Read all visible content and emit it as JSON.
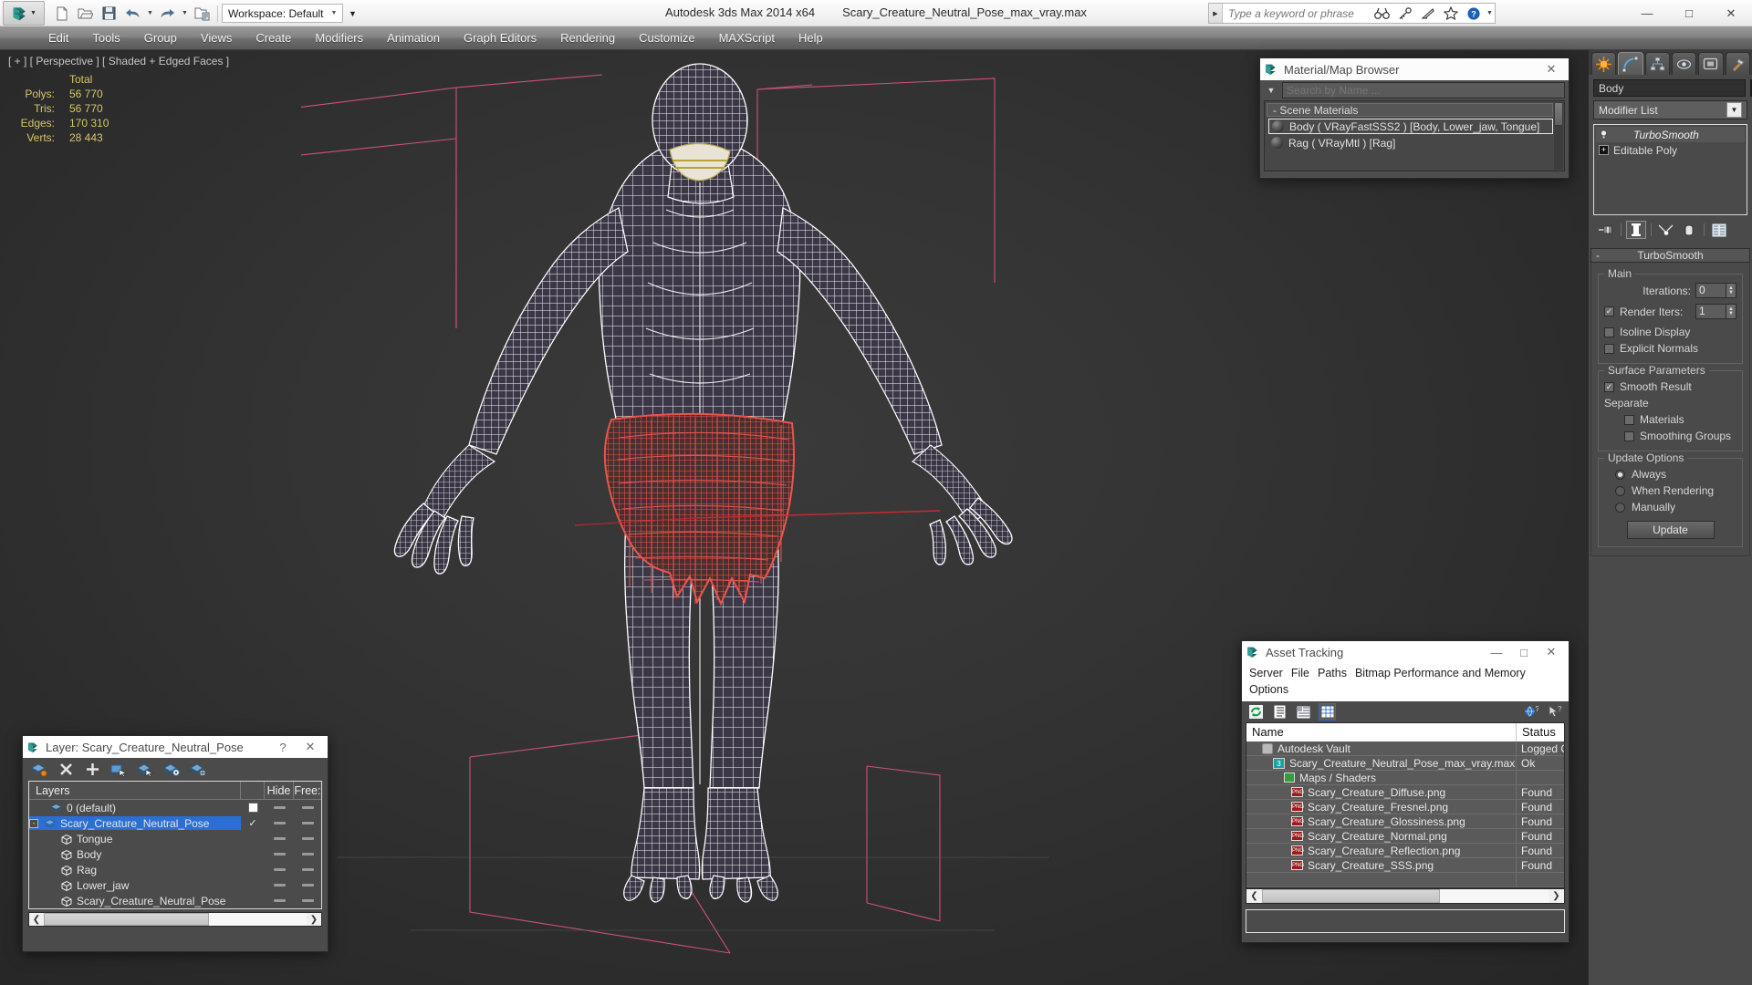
{
  "app": {
    "title": "Autodesk 3ds Max  2014 x64",
    "document": "Scary_Creature_Neutral_Pose_max_vray.max",
    "workspace_label": "Workspace: Default",
    "accent": "#2b6fd4"
  },
  "quick_access": [
    {
      "name": "new-file-icon",
      "label": "New"
    },
    {
      "name": "open-file-icon",
      "label": "Open"
    },
    {
      "name": "save-file-icon",
      "label": "Save"
    },
    {
      "name": "undo-icon",
      "label": "Undo"
    },
    {
      "name": "redo-icon",
      "label": "Redo"
    },
    {
      "name": "set-project-folder-icon",
      "label": "Set Project Folder"
    }
  ],
  "search": {
    "placeholder": "Type a keyword or phrase"
  },
  "titlebar_tools": [
    {
      "name": "binoculars-icon",
      "label": "Search"
    },
    {
      "name": "key-icon",
      "label": "Sign In"
    },
    {
      "name": "satellite-dish-icon",
      "label": "Autodesk 360"
    },
    {
      "name": "star-icon",
      "label": "Favorites"
    },
    {
      "name": "help-icon",
      "label": "Help"
    }
  ],
  "window_controls": {
    "minimize": "—",
    "maximize": "□",
    "close": "✕"
  },
  "menu": [
    "Edit",
    "Tools",
    "Group",
    "Views",
    "Create",
    "Modifiers",
    "Animation",
    "Graph Editors",
    "Rendering",
    "Customize",
    "MAXScript",
    "Help"
  ],
  "viewport": {
    "label": "[ + ] [ Perspective ] [ Shaded + Edged Faces ]",
    "stats": {
      "header": "Total",
      "rows": [
        {
          "label": "Polys:",
          "value": "56 770"
        },
        {
          "label": "Tris:",
          "value": "56 770"
        },
        {
          "label": "Edges:",
          "value": "170 310"
        },
        {
          "label": "Verts:",
          "value": "28 443"
        }
      ]
    },
    "colors": {
      "wireframe": "#ffffff",
      "selected_wireframe": "#e8554d",
      "surface": "#3c3747",
      "helper_pink": "#e8578f",
      "background": "#343434"
    }
  },
  "material_browser": {
    "title": "Material/Map Browser",
    "search_placeholder": "Search by Name ...",
    "group_label": "- Scene Materials",
    "items": [
      {
        "label": "Body  ( VRayFastSSS2 )  [Body, Lower_jaw, Tongue]",
        "selected": true
      },
      {
        "label": "Rag  ( VRayMtl )  [Rag]",
        "selected": false
      }
    ]
  },
  "command_panel": {
    "tabs": [
      {
        "name": "create-tab",
        "label": "Create"
      },
      {
        "name": "modify-tab",
        "label": "Modify",
        "active": true
      },
      {
        "name": "hierarchy-tab",
        "label": "Hierarchy"
      },
      {
        "name": "motion-tab",
        "label": "Motion"
      },
      {
        "name": "display-tab",
        "label": "Display"
      },
      {
        "name": "utilities-tab",
        "label": "Utilities"
      }
    ],
    "object_name": "Body",
    "object_color": "#eec6dd",
    "modifier_list_label": "Modifier List",
    "stack": [
      {
        "label": "TurboSmooth",
        "italic": true
      },
      {
        "label": "Editable Poly",
        "italic": false
      }
    ],
    "stack_tools": [
      {
        "name": "pin-stack-icon"
      },
      {
        "name": "show-end-result-icon"
      },
      {
        "name": "make-unique-icon"
      },
      {
        "name": "remove-modifier-icon"
      },
      {
        "name": "configure-modifier-sets-icon"
      }
    ],
    "turbosmooth": {
      "title": "TurboSmooth",
      "minus": "-",
      "main_label": "Main",
      "iterations_label": "Iterations:",
      "iterations_value": "0",
      "render_iters_label": "Render Iters:",
      "render_iters_value": "1",
      "render_iters_checked": true,
      "isoline_label": "Isoline Display",
      "isoline_checked": false,
      "explicit_normals_label": "Explicit Normals",
      "explicit_normals_checked": false,
      "surface_params_label": "Surface Parameters",
      "smooth_result_label": "Smooth Result",
      "smooth_result_checked": true,
      "separate_label": "Separate",
      "materials_label": "Materials",
      "materials_checked": false,
      "smoothing_groups_label": "Smoothing Groups",
      "smoothing_groups_checked": false,
      "update_options_label": "Update Options",
      "radios": [
        {
          "label": "Always",
          "selected": true
        },
        {
          "label": "When Rendering",
          "selected": false
        },
        {
          "label": "Manually",
          "selected": false
        }
      ],
      "update_button": "Update"
    }
  },
  "asset_tracking": {
    "title": "Asset Tracking",
    "menu": [
      "Server",
      "File",
      "Paths",
      "Bitmap Performance and Memory",
      "Options"
    ],
    "toolbar": [
      {
        "name": "refresh-icon",
        "active": false
      },
      {
        "name": "list-view-icon",
        "active": false
      },
      {
        "name": "report-view-icon",
        "active": false
      },
      {
        "name": "grid-view-icon",
        "active": true
      },
      {
        "name": "globe-help-icon",
        "active": false
      },
      {
        "name": "cursor-help-icon",
        "active": false
      }
    ],
    "columns": [
      "Name",
      "Status"
    ],
    "rows": [
      {
        "name": "Autodesk Vault",
        "status": "Logged O",
        "indent": 1,
        "icon": "vault-icon"
      },
      {
        "name": "Scary_Creature_Neutral_Pose_max_vray.max",
        "status": "Ok",
        "indent": 2,
        "icon": "max-file-icon"
      },
      {
        "name": "Maps / Shaders",
        "status": "",
        "indent": 3,
        "icon": "maps-shaders-icon"
      },
      {
        "name": "Scary_Creature_Diffuse.png",
        "status": "Found",
        "indent": 4,
        "icon": "png-icon"
      },
      {
        "name": "Scary_Creature_Fresnel.png",
        "status": "Found",
        "indent": 4,
        "icon": "png-icon"
      },
      {
        "name": "Scary_Creature_Glossiness.png",
        "status": "Found",
        "indent": 4,
        "icon": "png-icon"
      },
      {
        "name": "Scary_Creature_Normal.png",
        "status": "Found",
        "indent": 4,
        "icon": "png-icon"
      },
      {
        "name": "Scary_Creature_Reflection.png",
        "status": "Found",
        "indent": 4,
        "icon": "png-icon"
      },
      {
        "name": "Scary_Creature_SSS.png",
        "status": "Found",
        "indent": 4,
        "icon": "png-icon"
      }
    ]
  },
  "layer_dialog": {
    "title": "Layer: Scary_Creature_Neutral_Pose",
    "help_glyph": "?",
    "close_glyph": "✕",
    "tools": [
      {
        "name": "create-new-layer-icon"
      },
      {
        "name": "delete-layer-icon"
      },
      {
        "name": "add-selection-to-layer-icon"
      },
      {
        "name": "select-objects-in-layer-icon"
      },
      {
        "name": "highlight-selected-objects-layer-icon"
      },
      {
        "name": "hide-unhide-layer-icon"
      },
      {
        "name": "layer-properties-icon"
      }
    ],
    "columns": [
      "Layers",
      "Hide",
      "Free:"
    ],
    "rows": [
      {
        "label": "0 (default)",
        "type": "layer",
        "indent": 1,
        "selected": false,
        "current": false,
        "expander": ""
      },
      {
        "label": "Scary_Creature_Neutral_Pose",
        "type": "layer",
        "indent": 0,
        "selected": true,
        "current": true,
        "expander": "-"
      },
      {
        "label": "Tongue",
        "type": "object",
        "indent": 2,
        "selected": false,
        "current": false,
        "expander": ""
      },
      {
        "label": "Body",
        "type": "object",
        "indent": 2,
        "selected": false,
        "current": false,
        "expander": ""
      },
      {
        "label": "Rag",
        "type": "object",
        "indent": 2,
        "selected": false,
        "current": false,
        "expander": ""
      },
      {
        "label": "Lower_jaw",
        "type": "object",
        "indent": 2,
        "selected": false,
        "current": false,
        "expander": ""
      },
      {
        "label": "Scary_Creature_Neutral_Pose",
        "type": "object",
        "indent": 2,
        "selected": false,
        "current": false,
        "expander": ""
      }
    ]
  }
}
